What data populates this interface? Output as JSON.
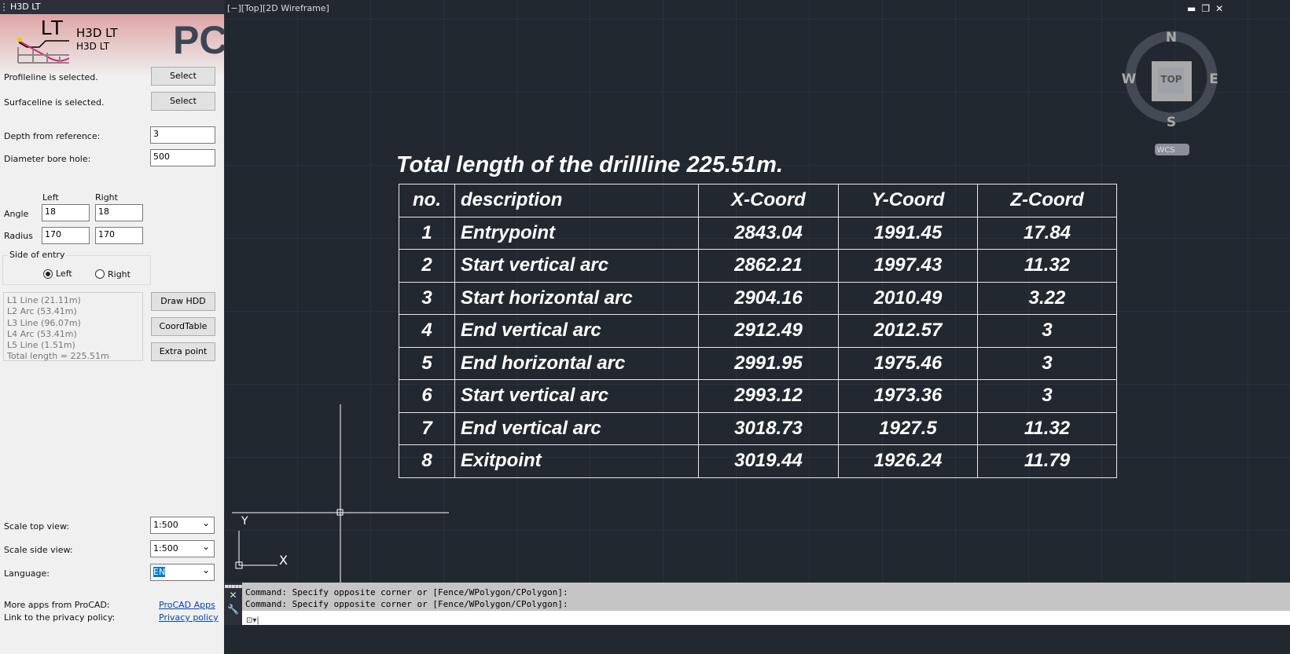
{
  "panel": {
    "title": "H3D LT",
    "product_title": "H3D LT",
    "product_subtitle": "H3D LT",
    "logo_text": "LT",
    "brand_text": "PC",
    "profile_status": "Profileline is selected.",
    "surface_status": "Surfaceline is selected.",
    "select_label": "Select",
    "depth_label": "Depth from reference:",
    "depth_value": "3",
    "diameter_label": "Diameter bore hole:",
    "diameter_value": "500",
    "left_header": "Left",
    "right_header": "Right",
    "angle_label": "Angle",
    "angle_left": "18",
    "angle_right": "18",
    "radius_label": "Radius",
    "radius_left": "170",
    "radius_right": "170",
    "side_group": "Side of entry",
    "side_left": "Left",
    "side_right": "Right",
    "side_selected": "Left",
    "segments": [
      "L1 Line (21.11m)",
      "L2 Arc (53.41m)",
      "L3 Line (96.07m)",
      "L4 Arc (53.41m)",
      "L5 Line (1.51m)",
      "Total length = 225.51m"
    ],
    "draw_hdd": "Draw HDD",
    "coord_table": "CoordTable",
    "extra_point": "Extra point",
    "scale_top_label": "Scale top view:",
    "scale_top_value": "1:500",
    "scale_side_label": "Scale side view:",
    "scale_side_value": "1:500",
    "language_label": "Language:",
    "language_value": "EN",
    "more_apps_label": "More apps from ProCAD:",
    "more_apps_link": "ProCAD Apps",
    "privacy_label": "Link to the privacy policy:",
    "privacy_link": "Privacy policy"
  },
  "viewport": {
    "label": "[−][Top][2D Wireframe]",
    "compass": {
      "n": "N",
      "s": "S",
      "e": "E",
      "w": "W",
      "top": "TOP"
    },
    "wcs": "WCS",
    "axis_x": "X",
    "axis_y": "Y",
    "drawing_title": "Total length of the drillline 225.51m.",
    "table": {
      "headers": [
        "no.",
        "description",
        "X-Coord",
        "Y-Coord",
        "Z-Coord"
      ],
      "rows": [
        [
          "1",
          "Entrypoint",
          "2843.04",
          "1991.45",
          "17.84"
        ],
        [
          "2",
          "Start vertical arc",
          "2862.21",
          "1997.43",
          "11.32"
        ],
        [
          "3",
          "Start horizontal arc",
          "2904.16",
          "2010.49",
          "3.22"
        ],
        [
          "4",
          "End vertical arc",
          "2912.49",
          "2012.57",
          "3"
        ],
        [
          "5",
          "End horizontal arc",
          "2991.95",
          "1975.46",
          "3"
        ],
        [
          "6",
          "Start vertical arc",
          "2993.12",
          "1973.36",
          "3"
        ],
        [
          "7",
          "End vertical arc",
          "3018.73",
          "1927.5",
          "11.32"
        ],
        [
          "8",
          "Exitpoint",
          "3019.44",
          "1926.24",
          "11.79"
        ]
      ]
    }
  },
  "command": {
    "history": [
      "Command: Specify opposite corner or [Fence/WPolygon/CPolygon]:",
      "Command: Specify opposite corner or [Fence/WPolygon/CPolygon]:"
    ]
  }
}
